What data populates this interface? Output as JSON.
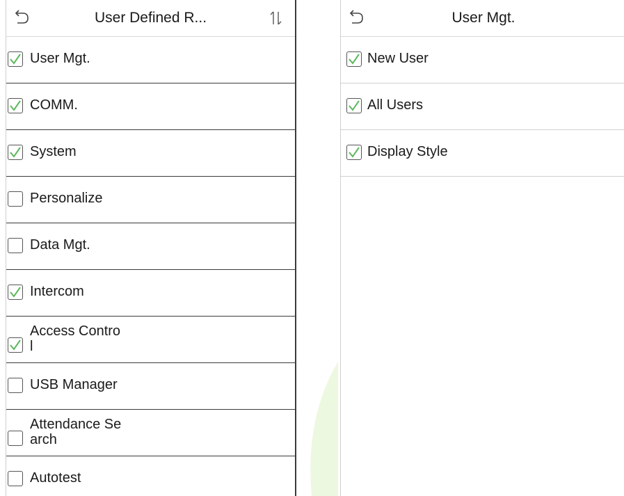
{
  "left": {
    "title": "User Defined R...",
    "items": [
      {
        "label": "User Mgt.",
        "checked": true
      },
      {
        "label": "COMM.",
        "checked": true
      },
      {
        "label": "System",
        "checked": true
      },
      {
        "label": "Personalize",
        "checked": false
      },
      {
        "label": "Data Mgt.",
        "checked": false
      },
      {
        "label": "Intercom",
        "checked": true
      },
      {
        "label_line1": "Access Contro",
        "label_line2": "l",
        "checked": true
      },
      {
        "label": "USB Manager",
        "checked": false
      },
      {
        "label_line1": "Attendance Se",
        "label_line2": "arch",
        "checked": false
      },
      {
        "label": "Autotest",
        "checked": false
      }
    ]
  },
  "right": {
    "title": "User Mgt.",
    "items": [
      {
        "label": "New User",
        "checked": true
      },
      {
        "label": "All Users",
        "checked": true
      },
      {
        "label": "Display Style",
        "checked": true
      }
    ]
  },
  "colors": {
    "check": "#5cb85c",
    "divider": "#3a3a3a",
    "checkbox_border": "#555555"
  },
  "icons": {
    "back": "back-arrow-icon",
    "sort": "sort-arrows-icon",
    "check": "checkmark-icon"
  }
}
